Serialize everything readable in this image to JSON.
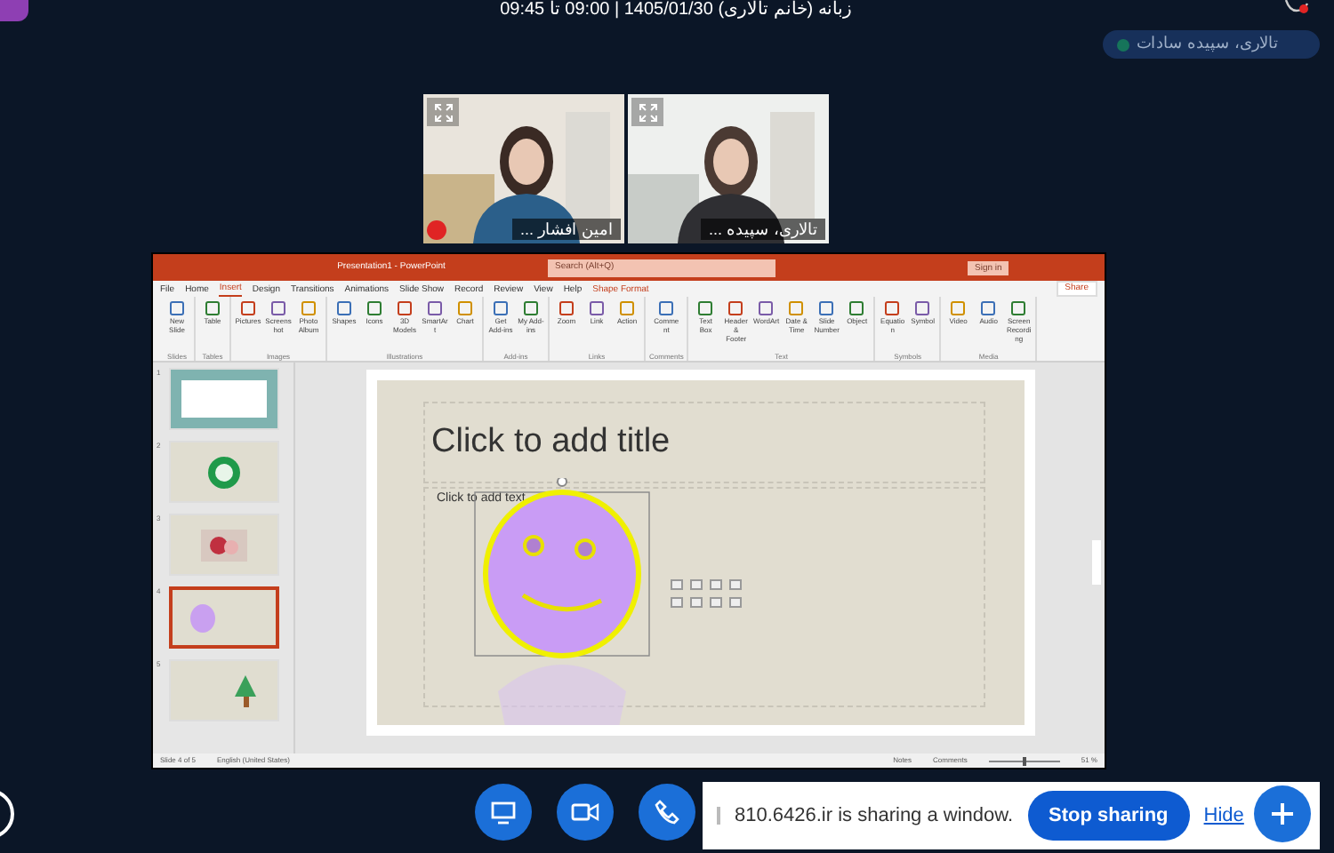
{
  "meeting": {
    "title": "زبانه (خانم تالاری) 1405/01/30 | 09:00 تا 09:45",
    "presenter": "تالاری، سپیده سادات"
  },
  "videos": [
    {
      "name": "تالاری، سپیده ..."
    },
    {
      "name": "امین افشار ..."
    }
  ],
  "powerpoint": {
    "title": "Presentation1 - PowerPoint",
    "search": "Search (Alt+Q)",
    "sign_in": "Sign in",
    "share": "Share",
    "menu": [
      {
        "label": "File",
        "selected": false
      },
      {
        "label": "Home",
        "selected": false
      },
      {
        "label": "Insert",
        "selected": true
      },
      {
        "label": "Design",
        "selected": false
      },
      {
        "label": "Transitions",
        "selected": false
      },
      {
        "label": "Animations",
        "selected": false
      },
      {
        "label": "Slide Show",
        "selected": false
      },
      {
        "label": "Record",
        "selected": false
      },
      {
        "label": "Review",
        "selected": false
      },
      {
        "label": "View",
        "selected": false
      },
      {
        "label": "Help",
        "selected": false
      },
      {
        "label": "Shape Format",
        "selected": false
      }
    ],
    "ribbon_groups": [
      {
        "label": "Slides",
        "buttons": [
          "New Slide"
        ]
      },
      {
        "label": "Tables",
        "buttons": [
          "Table"
        ]
      },
      {
        "label": "Images",
        "buttons": [
          "Pictures",
          "Screenshot",
          "Photo Album"
        ]
      },
      {
        "label": "Illustrations",
        "buttons": [
          "Shapes",
          "Icons",
          "3D Models",
          "SmartArt",
          "Chart"
        ]
      },
      {
        "label": "Add-ins",
        "buttons": [
          "Get Add-ins",
          "My Add-ins"
        ]
      },
      {
        "label": "Links",
        "buttons": [
          "Zoom",
          "Link",
          "Action"
        ]
      },
      {
        "label": "Comments",
        "buttons": [
          "Comment"
        ]
      },
      {
        "label": "Text",
        "buttons": [
          "Text Box",
          "Header & Footer",
          "WordArt",
          "Date & Time",
          "Slide Number",
          "Object"
        ]
      },
      {
        "label": "Symbols",
        "buttons": [
          "Equation",
          "Symbol"
        ]
      },
      {
        "label": "Media",
        "buttons": [
          "Video",
          "Audio",
          "Screen Recording"
        ]
      }
    ],
    "slides": [
      {
        "number": "1",
        "kind": "frame",
        "selected": false
      },
      {
        "number": "2",
        "kind": "badge",
        "selected": false
      },
      {
        "number": "3",
        "selected": false
      },
      {
        "number": "4",
        "kind": "smiley",
        "selected": true
      },
      {
        "number": "5",
        "kind": "tree",
        "selected": false
      }
    ],
    "slide": {
      "title_placeholder": "Click to add title",
      "body_placeholder": "Click to add text"
    },
    "status_bar": {
      "slide_count": "Slide 4 of 5",
      "language": "English (United States)",
      "notes": "Notes",
      "comments": "Comments",
      "zoom": "51 %",
      "zoom_slider": {
        "level": 0.5
      }
    }
  },
  "share_bar": {
    "message": "810.6426.ir is sharing a window.",
    "stop": "Stop sharing",
    "hide": "Hide"
  }
}
